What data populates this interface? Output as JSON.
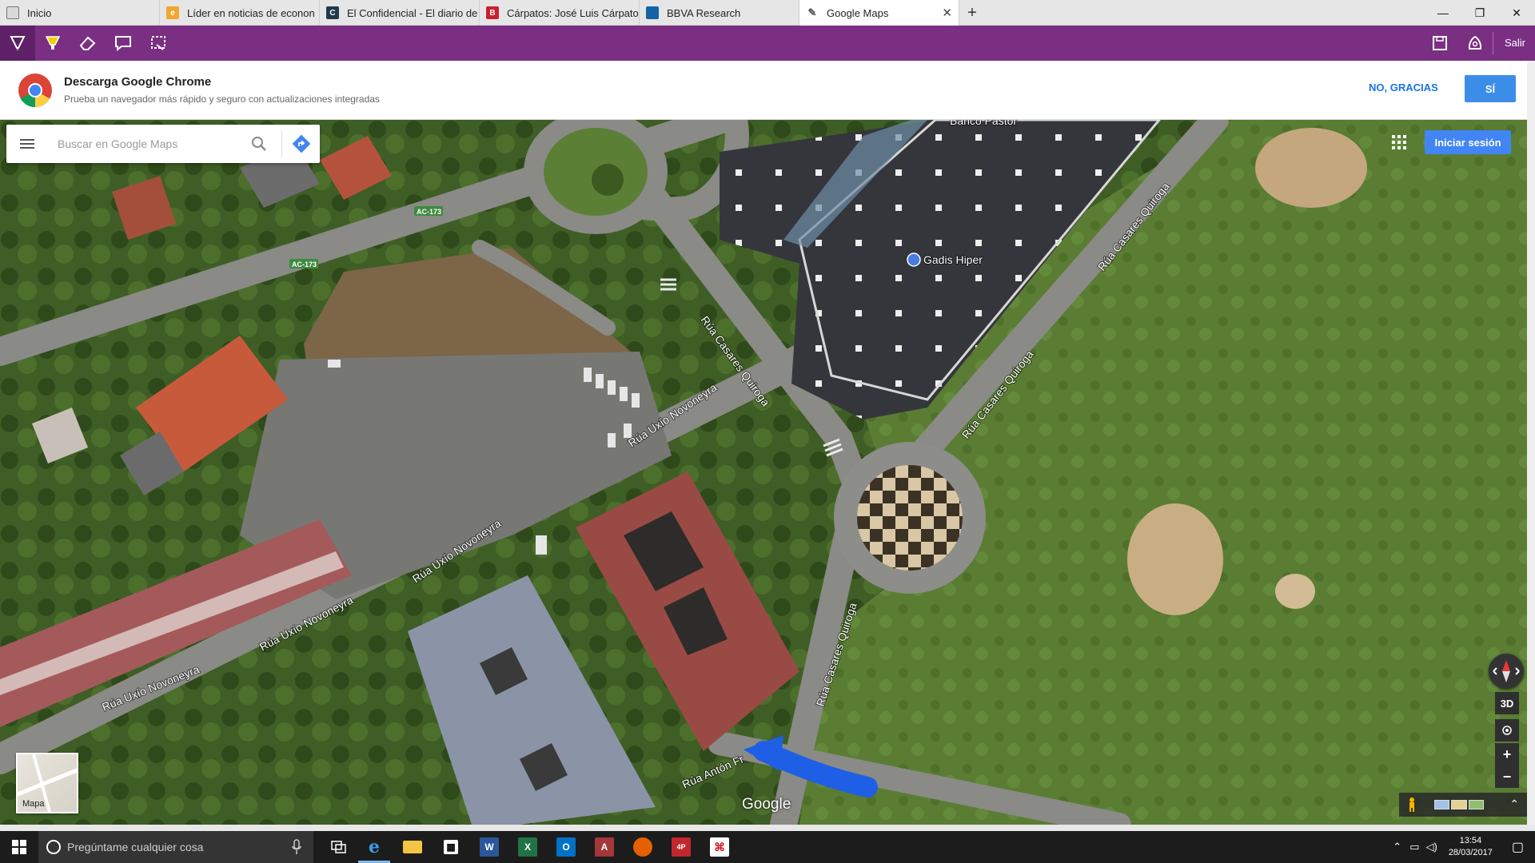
{
  "tabs": [
    {
      "title": "Inicio",
      "favicon_color": "#555555",
      "favicon_glyph": ""
    },
    {
      "title": "Líder en noticias de econon",
      "favicon_color": "#f2a530",
      "favicon_glyph": "e"
    },
    {
      "title": "El Confidencial - El diario de",
      "favicon_color": "#1f3b4d",
      "favicon_glyph": "C"
    },
    {
      "title": "Cárpatos: José Luis Cárpato",
      "favicon_color": "#c8202e",
      "favicon_glyph": "B"
    },
    {
      "title": "BBVA Research",
      "favicon_color": "#1464a5",
      "favicon_glyph": ""
    },
    {
      "title": "Google Maps",
      "favicon_color": "#6b6b6b",
      "favicon_glyph": "✎"
    }
  ],
  "toolbar": {
    "exit_label": "Salir",
    "tools": [
      "pen-icon",
      "highlighter-icon",
      "eraser-icon",
      "comment-icon",
      "clip-icon"
    ]
  },
  "promo": {
    "title": "Descarga Google Chrome",
    "subtitle": "Prueba un navegador más rápido y seguro con actualizaciones integradas",
    "no_label": "NO, GRACIAS",
    "yes_label": "SÍ"
  },
  "search": {
    "placeholder": "Buscar en Google Maps"
  },
  "map": {
    "signin_label": "Iniciar sesión",
    "layer_label": "Mapa",
    "google_logo": "Google",
    "btn_3d": "3D",
    "zoom_in": "+",
    "zoom_out": "−",
    "labels": {
      "banco": "Banco Pastor",
      "gadis": "Gadis Hiper",
      "rua_cq_1": "Rúa Casares Quiroga",
      "rua_cq_2": "Rúa Casares Quiroga",
      "rua_cq_3": "Rúa Casares Quiroga",
      "rua_cq_4": "Rúa Casares Quiroga",
      "rua_un_1": "Rúa Uxío Novoneyra",
      "rua_un_2": "Rúa Uxío Novoneyra",
      "rua_un_3": "Rúa Uxío Novoneyra",
      "rua_un_4": "Rúa Uxío Novoneyra",
      "rua_anton": "Rúa Antón Fr",
      "ac173_a": "AC-173",
      "ac173_b": "AC-173"
    }
  },
  "taskbar": {
    "search_placeholder": "Pregúntame cualquier cosa",
    "time": "13:54",
    "date": "28/03/2017"
  }
}
